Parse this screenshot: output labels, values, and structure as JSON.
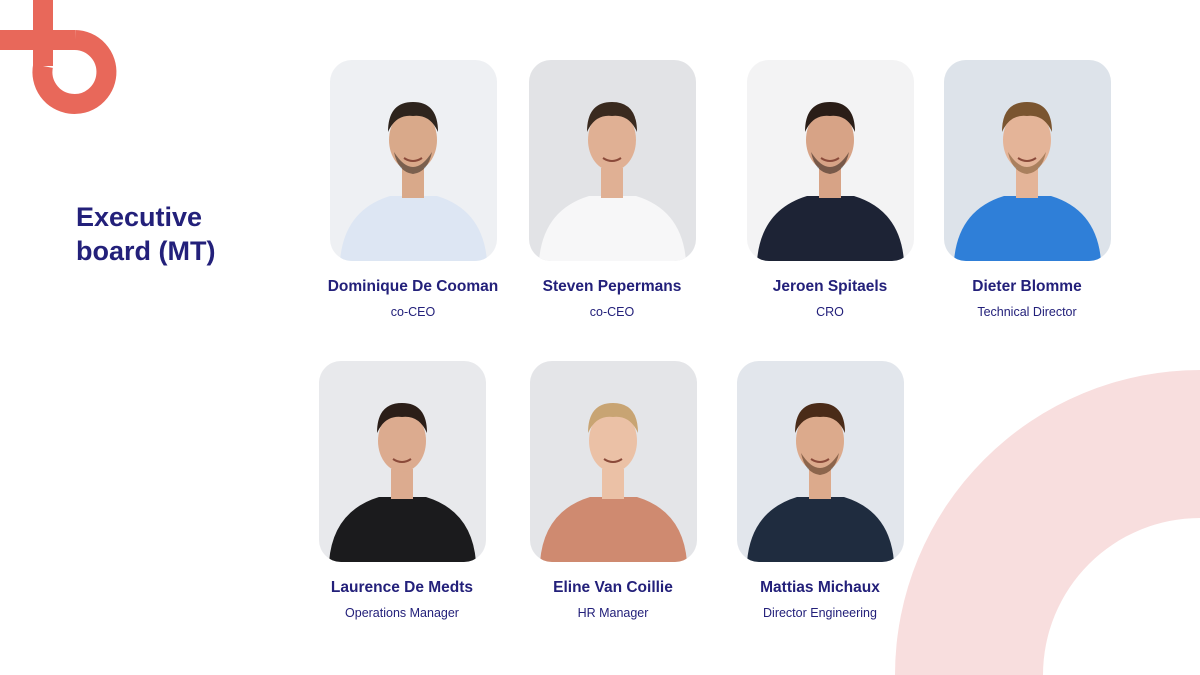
{
  "title": "Executive\nboard (MT)",
  "colors": {
    "brand": "#e8685a",
    "brand_light": "#f8dede",
    "text": "#23207a"
  },
  "members": [
    {
      "name": "Dominique De Cooman",
      "role": "co-CEO",
      "shirt": "#dde6f3",
      "bg": "#eef0f3",
      "hair": "#2e241d",
      "skin": "#d9a98a",
      "beard": "true"
    },
    {
      "name": "Steven Pepermans",
      "role": "co-CEO",
      "shirt": "#f7f7f8",
      "bg": "#e2e3e6",
      "hair": "#3a2a1f",
      "skin": "#e0b094",
      "beard": "false"
    },
    {
      "name": "Jeroen Spitaels",
      "role": "CRO",
      "shirt": "#1d2335",
      "bg": "#f3f3f4",
      "hair": "#2a1d17",
      "skin": "#d7a386",
      "beard": "true"
    },
    {
      "name": "Dieter Blomme",
      "role": "Technical Director",
      "shirt": "#2f7fd8",
      "bg": "#dde3ea",
      "hair": "#7a5530",
      "skin": "#e4b498",
      "beard": "true"
    },
    {
      "name": "Laurence De Medts",
      "role": "Operations Manager",
      "shirt": "#1b1b1d",
      "bg": "#e8e9ec",
      "hair": "#2b1e18",
      "skin": "#dcab8f",
      "beard": "false"
    },
    {
      "name": "Eline Van Coillie",
      "role": "HR Manager",
      "shirt": "#cf8a70",
      "bg": "#e4e5e8",
      "hair": "#c8a473",
      "skin": "#ebc1a6",
      "beard": "false"
    },
    {
      "name": "Mattias Michaux",
      "role": "Director Engineering",
      "shirt": "#1f2c3f",
      "bg": "#e2e6ec",
      "hair": "#4a2b18",
      "skin": "#dcaa8c",
      "beard": "true"
    }
  ]
}
